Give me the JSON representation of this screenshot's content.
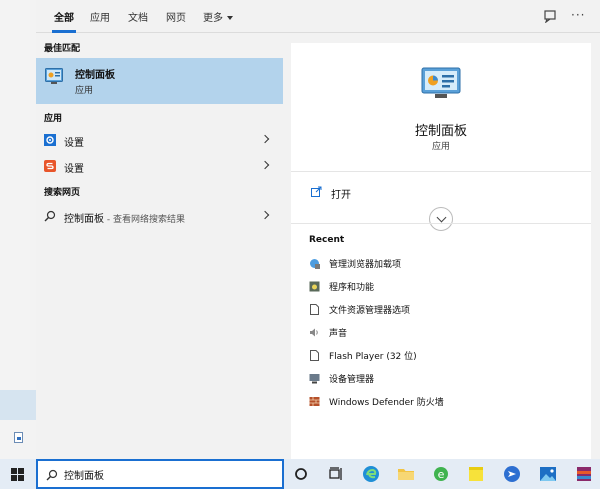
{
  "tabs": [
    {
      "label": "全部",
      "active": true
    },
    {
      "label": "应用"
    },
    {
      "label": "文档"
    },
    {
      "label": "网页"
    },
    {
      "label": "更多"
    }
  ],
  "more_dots": "···",
  "left": {
    "best_match_heading": "最佳匹配",
    "best_match": {
      "title": "控制面板",
      "subtitle": "应用"
    },
    "apps_heading": "应用",
    "apps": [
      {
        "label": "设置",
        "icon": "gear-icon"
      },
      {
        "label": "设置",
        "icon": "settings-s-icon"
      }
    ],
    "web_heading": "搜索网页",
    "web_item": {
      "label": "控制面板",
      "sub": " - 查看网络搜索结果",
      "icon": "search-icon"
    }
  },
  "preview": {
    "title": "控制面板",
    "subtitle": "应用",
    "open_label": "打开",
    "recent_heading": "Recent",
    "recent": [
      {
        "label": "管理浏览器加载项",
        "icon": "browser-addon-icon"
      },
      {
        "label": "程序和功能",
        "icon": "programs-icon"
      },
      {
        "label": "文件资源管理器选项",
        "icon": "file-icon"
      },
      {
        "label": "声音",
        "icon": "speaker-icon"
      },
      {
        "label": "Flash Player (32 位)",
        "icon": "file-icon"
      },
      {
        "label": "设备管理器",
        "icon": "device-manager-icon"
      },
      {
        "label": "Windows Defender 防火墙",
        "icon": "firewall-icon"
      }
    ]
  },
  "taskbar": {
    "search_value": "控制面板",
    "apps": [
      "cortana-icon",
      "task-view-icon",
      "edge-icon",
      "file-explorer-icon",
      "ie-icon",
      "sticky-notes-icon",
      "feedback-app-icon",
      "photos-icon",
      "winrar-icon"
    ]
  },
  "colors": {
    "accent": "#1a6fd1",
    "selected": "#b3d3ec"
  }
}
